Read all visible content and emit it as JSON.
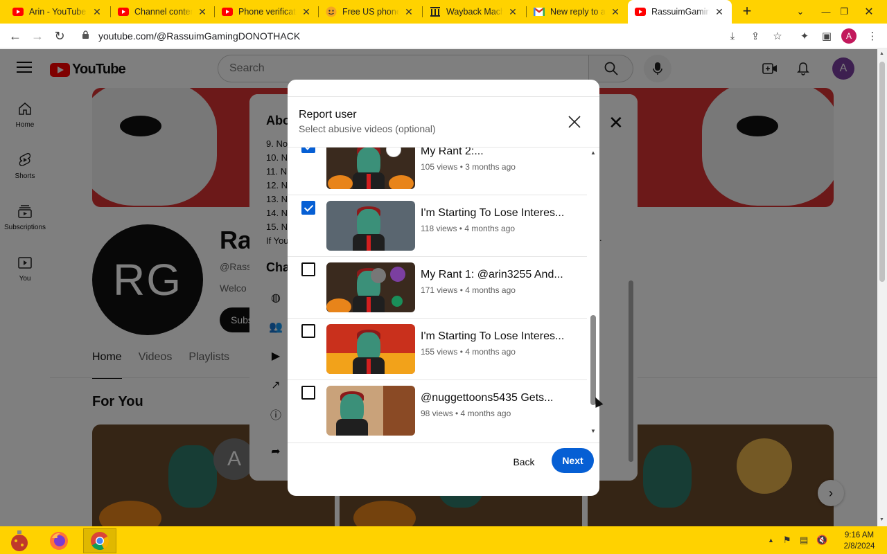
{
  "browser": {
    "tabs": [
      {
        "title": "Arin - YouTube",
        "icon": "youtube-icon"
      },
      {
        "title": "Channel content",
        "icon": "youtube-icon"
      },
      {
        "title": "Phone verification",
        "icon": "youtube-icon"
      },
      {
        "title": "Free US phone",
        "icon": "smiley-icon"
      },
      {
        "title": "Wayback Machine",
        "icon": "archive-icon"
      },
      {
        "title": "New reply to a",
        "icon": "gmail-icon"
      },
      {
        "title": "RassuimGaming",
        "icon": "youtube-icon",
        "active": true
      }
    ],
    "url": "youtube.com/@RassuimGamingDONOTHACK",
    "profile_initial": "A",
    "tab_color": "#ffd200"
  },
  "youtube": {
    "logo_text": "YouTube",
    "search_placeholder": "Search",
    "avatar_initial": "A",
    "guide": [
      {
        "label": "Home",
        "icon": "home-icon"
      },
      {
        "label": "Shorts",
        "icon": "shorts-icon"
      },
      {
        "label": "Subscriptions",
        "icon": "subscriptions-icon"
      },
      {
        "label": "You",
        "icon": "you-icon"
      }
    ],
    "channel": {
      "avatar_text": "RG",
      "name_visible": "Ra",
      "handle_visible": "@Rass",
      "description_visible": "Welco",
      "subscribe_visible": "Subs",
      "tabs": [
        "Home",
        "Videos",
        "Playlists"
      ],
      "active_tab": "Home",
      "section_title": "For You",
      "carousel_avatar": "A"
    }
  },
  "about_dialog": {
    "title_visible": "Abo",
    "list_visible": [
      "9. No",
      "10. N",
      "11. N",
      "12. N",
      "13. N",
      "14. N",
      "15. N",
      "If You"
    ],
    "section_visible": "Cha",
    "trailing_text": "."
  },
  "report_dialog": {
    "title": "Report user",
    "subtitle": "Select abusive videos (optional)",
    "videos": [
      {
        "title": "My Rant 2:...",
        "meta": "105 views • 3 months ago",
        "checked": true,
        "theme": "halloween"
      },
      {
        "title": "I'm Starting To Lose Interes...",
        "meta": "118 views • 4 months ago",
        "checked": true,
        "theme": "rain"
      },
      {
        "title": "My Rant 1: @arin3255 And...",
        "meta": "171 views • 4 months ago",
        "checked": false,
        "theme": "halloween"
      },
      {
        "title": "I'm Starting To Lose Interes...",
        "meta": "155 views • 4 months ago",
        "checked": false,
        "theme": "fire"
      },
      {
        "title": "@nuggettoons5435 Gets...",
        "meta": "98 views • 4 months ago",
        "checked": false,
        "theme": "room"
      }
    ],
    "back_label": "Back",
    "next_label": "Next",
    "accent": "#065fd4"
  },
  "taskbar": {
    "time": "9:16 AM",
    "date": "2/8/2024",
    "apps": [
      "ornament-icon",
      "firefox-icon",
      "chrome-icon"
    ]
  }
}
